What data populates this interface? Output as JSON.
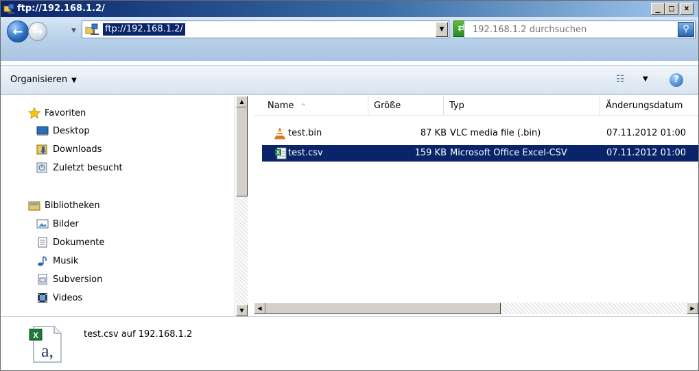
{
  "window": {
    "title": "ftp://192.168.1.2/",
    "buttons": {
      "minimize": "_",
      "maximize": "□",
      "close": "×"
    }
  },
  "address_bar": {
    "path": "ftp://192.168.1.2/",
    "search_placeholder": "192.168.1.2 durchsuchen"
  },
  "toolbar": {
    "organize_label": "Organisieren",
    "view_icon": "views-icon",
    "help_icon": "help-icon"
  },
  "nav_pane": {
    "favorites": {
      "label": "Favoriten",
      "items": [
        "Desktop",
        "Downloads",
        "Zuletzt besucht"
      ]
    },
    "libraries": {
      "label": "Bibliotheken",
      "items": [
        "Bilder",
        "Dokumente",
        "Musik",
        "Subversion",
        "Videos"
      ]
    }
  },
  "file_list": {
    "columns": [
      "Name",
      "Größe",
      "Typ",
      "Änderungsdatum"
    ],
    "sort_indicator": "^",
    "rows": [
      {
        "name": "test.bin",
        "size": "87 KB",
        "type": "VLC media file (.bin)",
        "date": "07.11.2012 01:00",
        "icon": "vlc-cone-icon",
        "selected": false
      },
      {
        "name": "test.csv",
        "size": "159 KB",
        "type": "Microsoft Office Excel-CSV",
        "date": "07.11.2012 01:00",
        "icon": "excel-csv-icon",
        "selected": true
      }
    ]
  },
  "details_pane": {
    "selected_label": "test.csv auf 192.168.1.2",
    "icon_glyph": "a,"
  },
  "colors": {
    "selection": "#0a246a",
    "titlebar_start": "#0a246a",
    "titlebar_end": "#a6caf0"
  }
}
